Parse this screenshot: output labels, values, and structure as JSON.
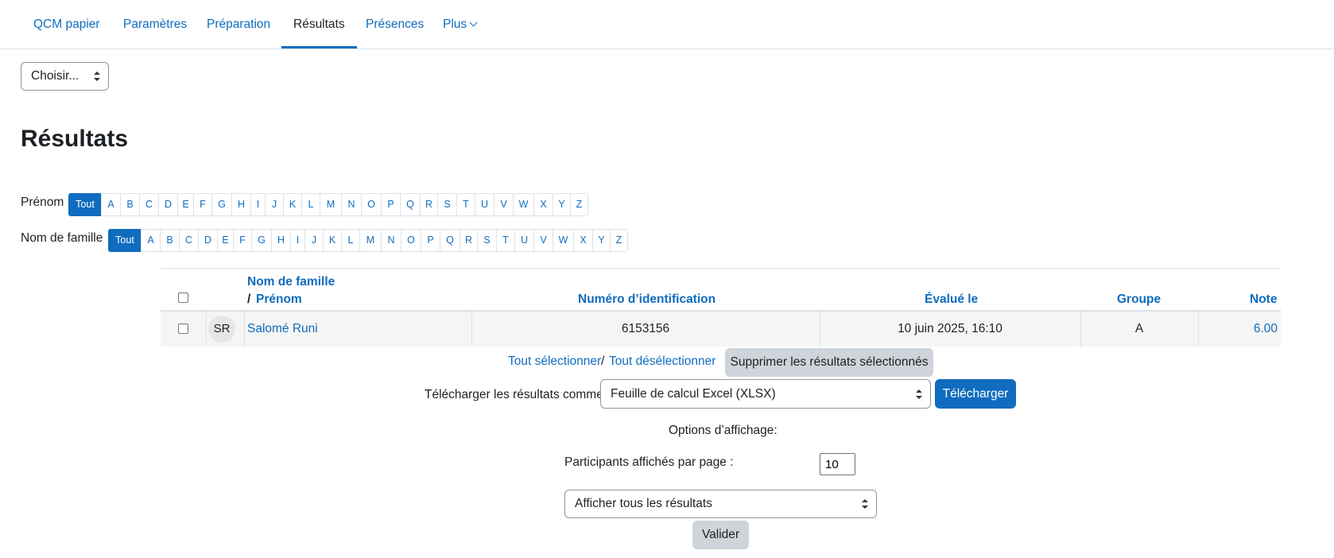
{
  "nav": {
    "tabs": [
      "QCM papier",
      "Paramètres",
      "Préparation",
      "Résultats",
      "Présences",
      "Plus"
    ],
    "active": "Résultats"
  },
  "jump_select": {
    "value": "Choisir..."
  },
  "page_title": "Résultats",
  "filters": {
    "firstname_label": "Prénom",
    "lastname_label": "Nom de famille",
    "all_label": "Tout",
    "letters": [
      "A",
      "B",
      "C",
      "D",
      "E",
      "F",
      "G",
      "H",
      "I",
      "J",
      "K",
      "L",
      "M",
      "N",
      "O",
      "P",
      "Q",
      "R",
      "S",
      "T",
      "U",
      "V",
      "W",
      "X",
      "Y",
      "Z"
    ]
  },
  "table": {
    "headers": {
      "lastname": "Nom de famille",
      "separator": "/",
      "firstname": "Prénom",
      "idnumber": "Numéro d’identification",
      "graded": "Évalué le",
      "group": "Groupe",
      "grade": "Note"
    },
    "rows": [
      {
        "initials": "SR",
        "name": "Salomé Runi",
        "idnumber": "6153156",
        "graded": "10 juin 2025, 16:10",
        "group": "A",
        "grade": "6.00"
      }
    ]
  },
  "actions": {
    "select_all": "Tout sélectionner",
    "separator": "/",
    "deselect_all": "Tout désélectionner",
    "delete_button": "Supprimer les résultats sélectionnés",
    "download_label": "Télécharger les résultats comme :",
    "download_format": "Feuille de calcul Excel (XLSX)",
    "download_button": "Télécharger"
  },
  "display": {
    "heading": "Options d’affichage:",
    "per_page_label": "Participants affichés par page :",
    "per_page_value": "10",
    "filter_select": "Afficher tous les résultats",
    "submit_button": "Valider"
  }
}
